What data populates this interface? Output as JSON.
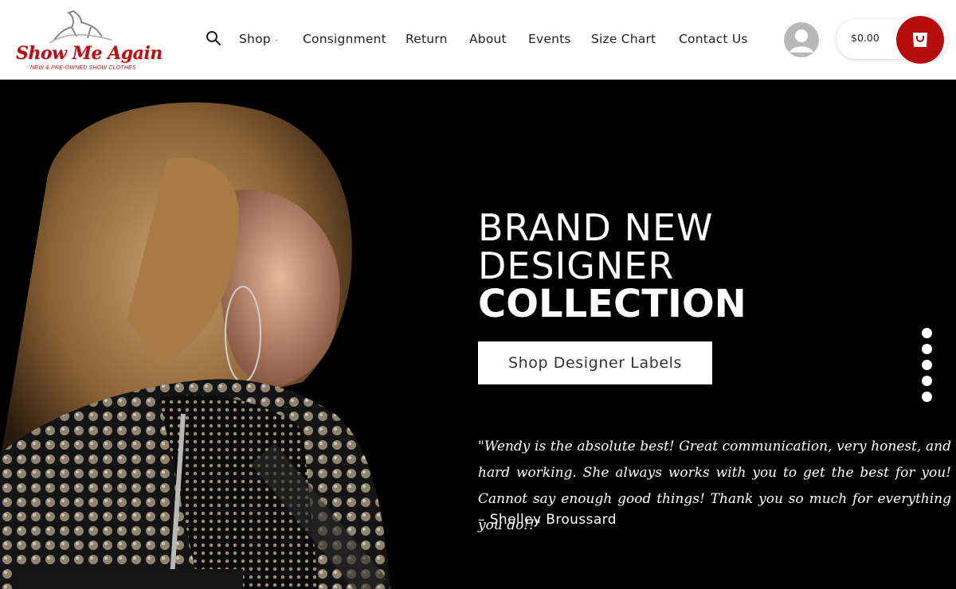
{
  "brand": {
    "logo_text": "Show Me Again",
    "tagline": "NEW & PRE-OWNED SHOW CLOTHES",
    "accent": "#b50d0d"
  },
  "nav": {
    "search_icon": "search-icon",
    "items": [
      {
        "label": "Shop",
        "has_dropdown": true
      },
      {
        "label": "Consignment"
      },
      {
        "label": "Return"
      },
      {
        "label": "About"
      },
      {
        "label": "Events"
      },
      {
        "label": "Size Chart"
      },
      {
        "label": "Contact Us"
      }
    ]
  },
  "account": {
    "icon": "user-icon"
  },
  "cart": {
    "total": "$0.00",
    "icon": "shopping-bag-icon"
  },
  "hero": {
    "headline": [
      "BRAND NEW",
      "DESIGNER",
      "COLLECTION"
    ],
    "cta": "Shop Designer Labels",
    "slider_dots": 5,
    "quote": "\"Wendy is the absolute best! Great communication, very honest, and hard working. She always works with you to get the best for you! Cannot say enough good things! Thank you so much for everything you do!!\"",
    "author": "– Shelley Broussard"
  }
}
